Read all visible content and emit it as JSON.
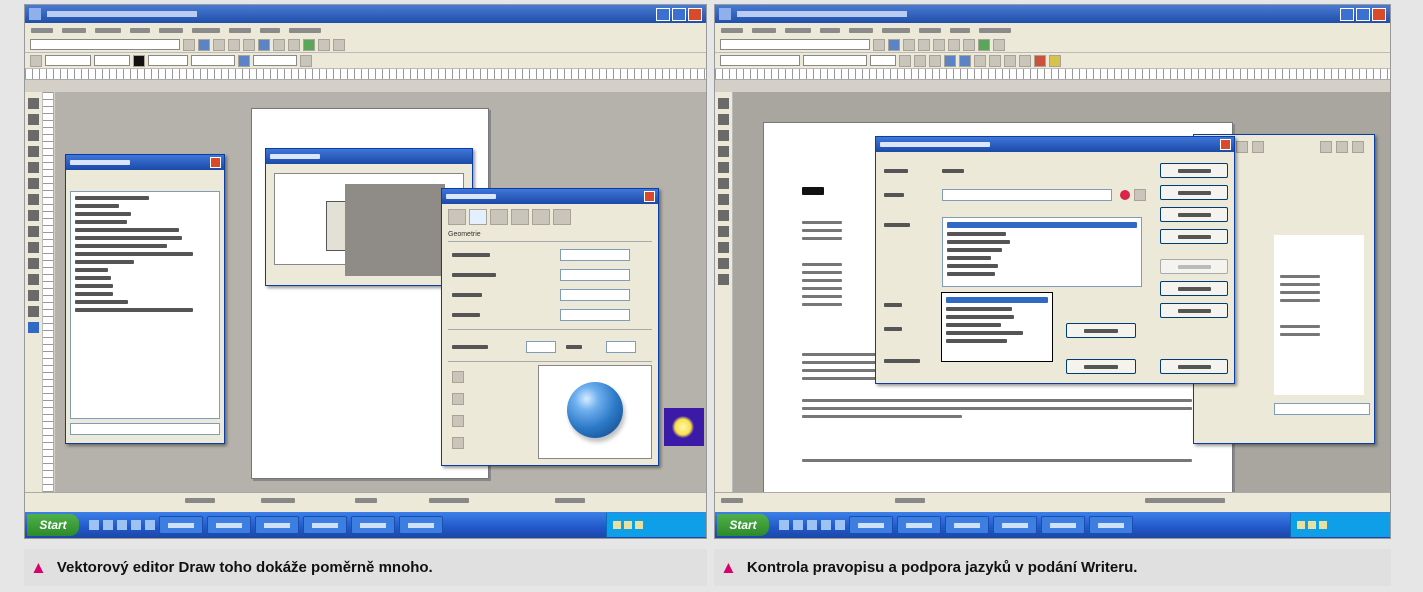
{
  "left_panel": {
    "start_label": "Start",
    "dialog_section_label": "Geometrie"
  },
  "right_panel": {
    "start_label": "Start"
  },
  "captions": {
    "left": "Vektorový editor Draw toho dokáže poměrně mnoho.",
    "right": "Kontrola pravopisu a podpora jazyků v podání Writeru."
  },
  "colors": {
    "caption_marker": "#d9006c",
    "titlebar": "#1f4fa8",
    "selection": "#316ac5",
    "sphere": "#2c79c7"
  },
  "icons": {
    "caption_marker": "triangle-up-icon"
  }
}
